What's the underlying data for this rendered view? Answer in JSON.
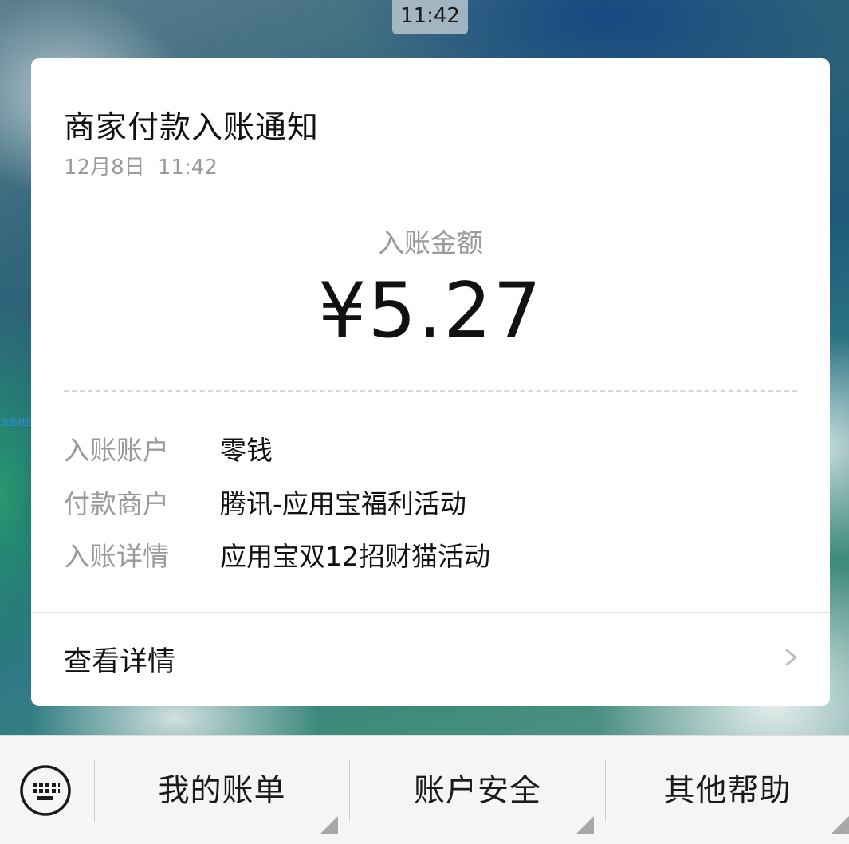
{
  "status": {
    "time": "11:42"
  },
  "watermark": "流星社区",
  "card": {
    "title": "商家付款入账通知",
    "date": "12月8日  11:42",
    "amount_label": "入账金额",
    "amount": "¥5.27",
    "details": [
      {
        "key": "入账账户",
        "value": "零钱"
      },
      {
        "key": "付款商户",
        "value": "腾讯-应用宝福利活动"
      },
      {
        "key": "入账详情",
        "value": "应用宝双12招财猫活动"
      }
    ],
    "view_details_label": "查看详情",
    "chevron_icon": "chevron-right-icon"
  },
  "bottom_menu": {
    "keyboard_icon": "keyboard-icon",
    "items": [
      {
        "label": "我的账单"
      },
      {
        "label": "账户安全"
      },
      {
        "label": "其他帮助"
      }
    ]
  },
  "colors": {
    "card_background": "#ffffff",
    "primary_text": "#111111",
    "secondary_text": "#9a9a9a",
    "menu_bar": "#f5f5f5"
  }
}
